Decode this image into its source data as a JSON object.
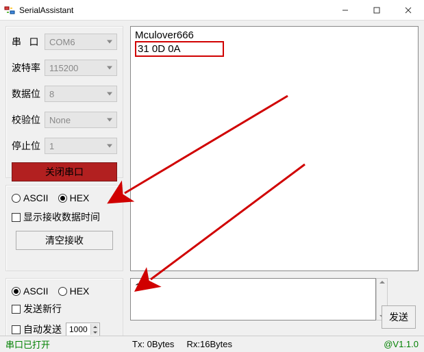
{
  "window": {
    "title": "SerialAssistant"
  },
  "config": {
    "port_label": "串 口",
    "port_value": "COM6",
    "baud_label": "波特率",
    "baud_value": "115200",
    "data_label": "数据位",
    "data_value": "8",
    "parity_label": "校验位",
    "parity_value": "None",
    "stop_label": "停止位",
    "stop_value": "1",
    "close_port": "关闭串口"
  },
  "recv": {
    "line1": "Mculover666",
    "line2": "31 0D 0A",
    "opt_ascii": "ASCII",
    "opt_hex": "HEX",
    "show_time": "显示接收数据时间",
    "clear": "清空接收"
  },
  "send": {
    "opt_ascii": "ASCII",
    "opt_hex": "HEX",
    "newline": "发送新行",
    "auto_send": "自动发送",
    "interval": "1000",
    "content": "1",
    "send_btn": "发送"
  },
  "status": {
    "port_open": "串口已打开",
    "tx": "Tx: 0Bytes",
    "rx": "Rx:16Bytes",
    "version": "@V1.1.0"
  }
}
